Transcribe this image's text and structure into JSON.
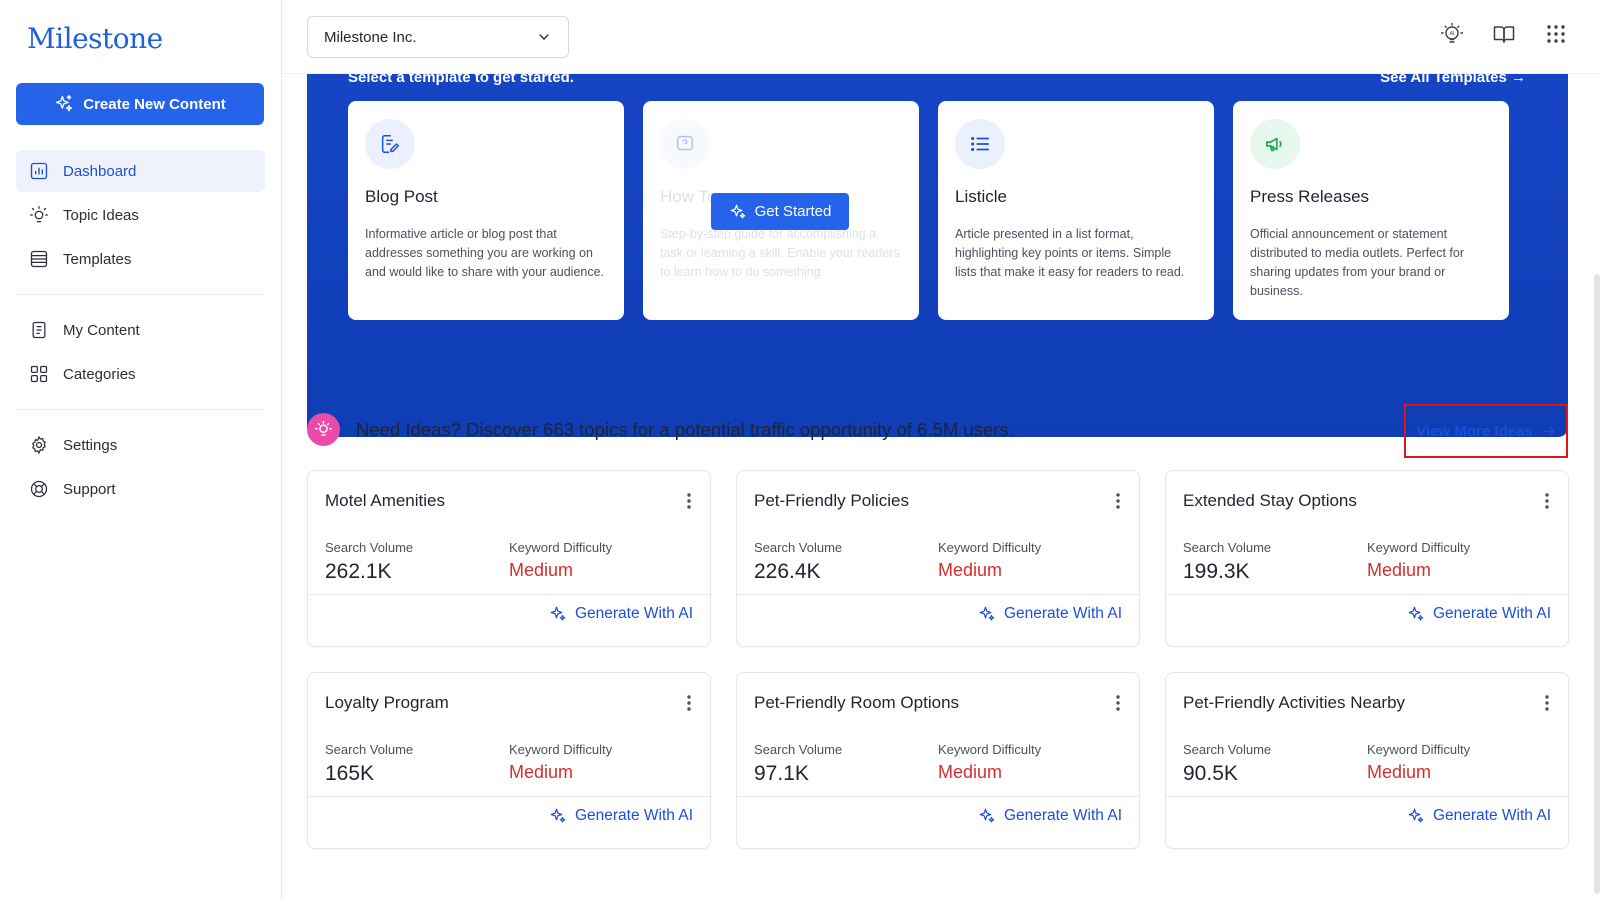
{
  "sidebar": {
    "logo": "Milestone",
    "create_label": "Create New Content",
    "items": [
      {
        "label": "Dashboard",
        "icon": "chart-bar-icon",
        "active": true
      },
      {
        "label": "Topic Ideas",
        "icon": "lightbulb-icon"
      },
      {
        "label": "Templates",
        "icon": "templates-icon"
      },
      {
        "label": "My Content",
        "icon": "document-icon"
      },
      {
        "label": "Categories",
        "icon": "grid-icon"
      },
      {
        "label": "Settings",
        "icon": "gear-icon"
      },
      {
        "label": "Support",
        "icon": "lifebuoy-icon"
      }
    ]
  },
  "topbar": {
    "org": "Milestone Inc.",
    "icons": [
      "ai-bulb-icon",
      "book-icon",
      "apps-grid-icon"
    ]
  },
  "hero": {
    "title": "Select a template to get started.",
    "see_all": "See All Templates →",
    "get_started": "Get Started",
    "templates": [
      {
        "title": "Blog Post",
        "desc": "Informative article or blog post that addresses something you are working on and would like to share with your audience.",
        "icon": "edit-doc-icon",
        "color": "#eaf0fd"
      },
      {
        "title": "How To",
        "desc": "Step-by-step guide for accomplishing a task or learning a skill. Enable your readers to learn how to do something.",
        "icon": "question-icon",
        "color": "#eaf0fd"
      },
      {
        "title": "Listicle",
        "desc": "Article presented in a list format, highlighting key points or items. Simple lists that make it easy for readers to read.",
        "icon": "list-icon",
        "color": "#eaf0fd"
      },
      {
        "title": "Press Releases",
        "desc": "Official announcement or statement distributed to media outlets. Perfect for sharing updates from your brand or business.",
        "icon": "megaphone-icon",
        "color": "#e6f7ee"
      }
    ]
  },
  "ideas": {
    "text": "Need Ideas? Discover 663 topics for a potential traffic opportunity of 6.5M users.",
    "view_more": "View More Ideas"
  },
  "topics": [
    {
      "title": "Motel Amenities",
      "volume": "262.1K",
      "difficulty": "Medium"
    },
    {
      "title": "Pet-Friendly Policies",
      "volume": "226.4K",
      "difficulty": "Medium"
    },
    {
      "title": "Extended Stay Options",
      "volume": "199.3K",
      "difficulty": "Medium"
    },
    {
      "title": "Loyalty Program",
      "volume": "165K",
      "difficulty": "Medium"
    },
    {
      "title": "Pet-Friendly Room Options",
      "volume": "97.1K",
      "difficulty": "Medium"
    },
    {
      "title": "Pet-Friendly Activities Nearby",
      "volume": "90.5K",
      "difficulty": "Medium"
    }
  ],
  "labels": {
    "search_volume": "Search Volume",
    "keyword_difficulty": "Keyword Difficulty",
    "generate": "Generate With AI"
  },
  "colors": {
    "accent": "#2563eb",
    "hero": "#1746c6",
    "difficulty": "#d62e2e",
    "highlight": "#e0141b"
  }
}
